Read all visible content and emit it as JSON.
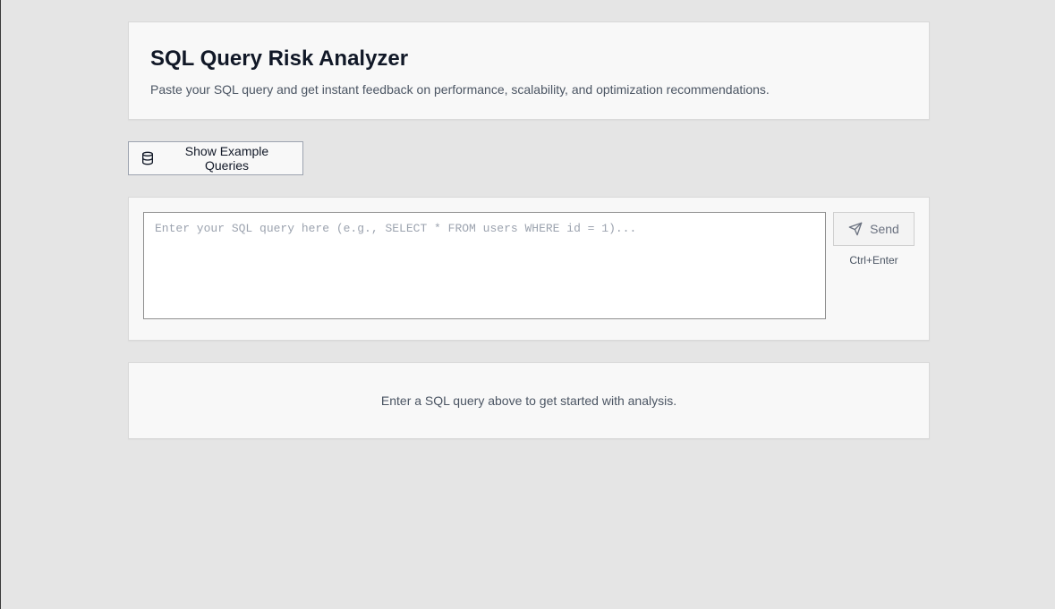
{
  "header": {
    "title": "SQL Query Risk Analyzer",
    "subtitle": "Paste your SQL query and get instant feedback on performance, scalability, and optimization recommendations."
  },
  "examples_button": {
    "label": "Show Example Queries",
    "icon": "database-icon"
  },
  "query_input": {
    "value": "",
    "placeholder": "Enter your SQL query here (e.g., SELECT * FROM users WHERE id = 1)..."
  },
  "send_button": {
    "label": "Send",
    "icon": "send-icon",
    "shortcut": "Ctrl+Enter"
  },
  "results": {
    "empty_message": "Enter a SQL query above to get started with analysis."
  }
}
